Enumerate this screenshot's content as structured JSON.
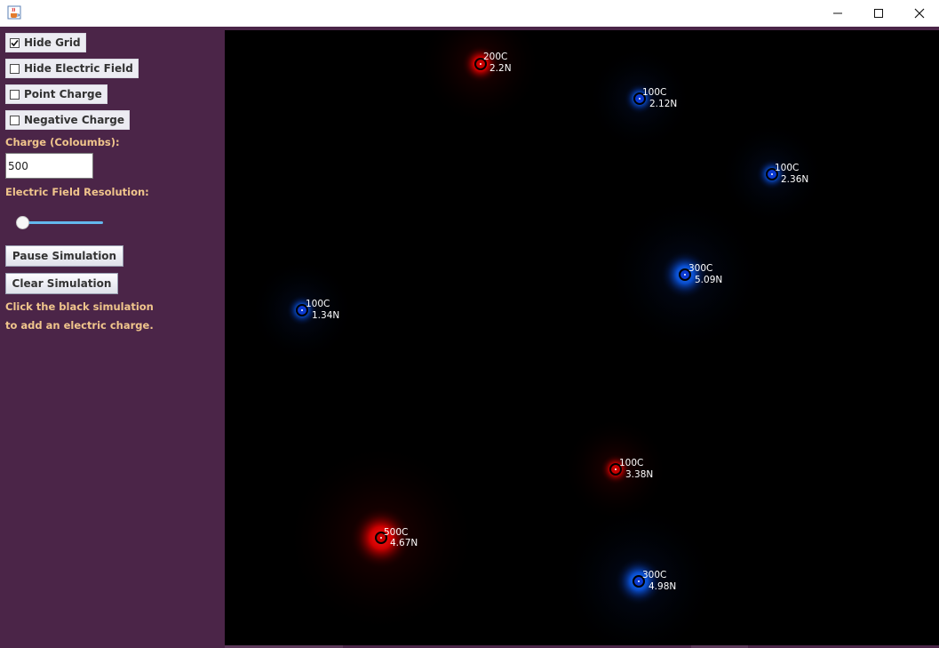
{
  "window": {
    "minimize_icon": "minimize-icon",
    "maximize_icon": "maximize-icon",
    "close_icon": "close-icon",
    "app_icon": "java-cup-icon"
  },
  "controls": {
    "hide_grid": {
      "label": "Hide Grid",
      "checked": true
    },
    "hide_field": {
      "label": "Hide Electric Field",
      "checked": false
    },
    "point_charge": {
      "label": "Point Charge",
      "checked": false
    },
    "negative_charge": {
      "label": "Negative Charge",
      "checked": false
    },
    "charge_label": "Charge (Coloumbs):",
    "charge_value": "500",
    "resolution_label": "Electric Field Resolution:",
    "resolution_level": 0,
    "pause_label": "Pause Simulation",
    "clear_label": "Clear Simulation",
    "hint_line1": "Click the black simulation",
    "hint_line2": "to add an electric charge."
  },
  "colors": {
    "panel_bg": "#4b2548",
    "label_color": "#f0c58c",
    "positive": "#ff1010",
    "negative": "#1060ff",
    "slider_track": "#63b8ee"
  },
  "charges": [
    {
      "charge": "200C",
      "force": "2.2N",
      "polarity": "positive"
    },
    {
      "charge": "100C",
      "force": "2.12N",
      "polarity": "negative"
    },
    {
      "charge": "100C",
      "force": "2.36N",
      "polarity": "negative"
    },
    {
      "charge": "300C",
      "force": "5.09N",
      "polarity": "negative"
    },
    {
      "charge": "100C",
      "force": "1.34N",
      "polarity": "negative"
    },
    {
      "charge": "100C",
      "force": "3.38N",
      "polarity": "positive"
    },
    {
      "charge": "500C",
      "force": "4.67N",
      "polarity": "positive"
    },
    {
      "charge": "300C",
      "force": "4.98N",
      "polarity": "negative"
    }
  ]
}
